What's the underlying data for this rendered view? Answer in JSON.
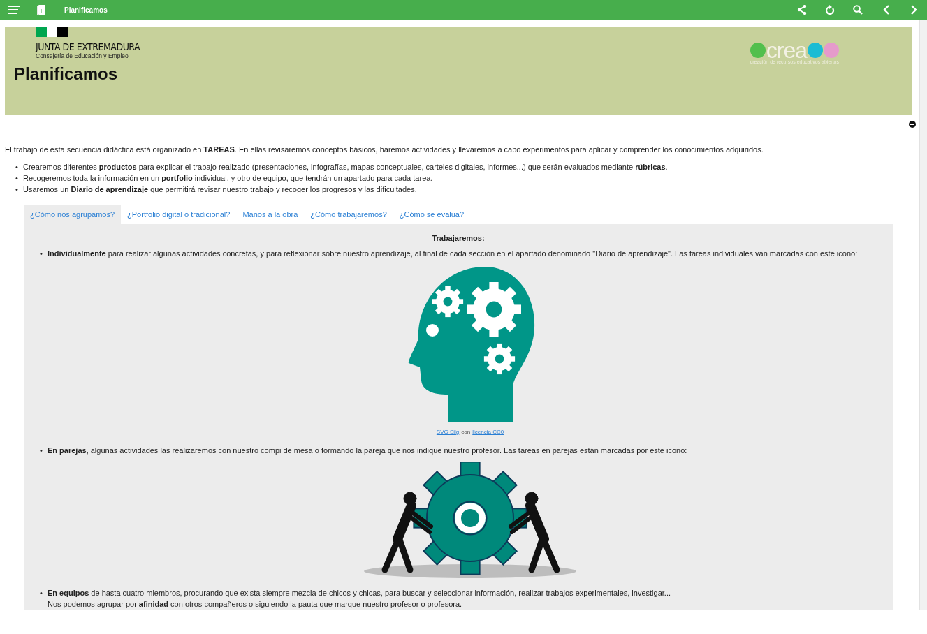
{
  "toolbar": {
    "title": "Planificamos"
  },
  "banner": {
    "org_name": "JUNTA DE EXTREMADURA",
    "org_subtitle": "Consejería de Educación y Empleo",
    "title": "Planificamos",
    "logo_text": "crea",
    "logo_tagline": "creación de recursos educativos abiertos"
  },
  "intro": "El trabajo de esta secuencia didáctica está organizado en **TAREAS**. En ellas revisaremos conceptos básicos, haremos actividades y llevaremos a cabo experimentos para aplicar y comprender los conocimientos adquiridos.",
  "bullets": [
    {
      "marker": "•",
      "text": "Crearemos diferentes **productos** para explicar el trabajo realizado (presentaciones, infografías, mapas conceptuales, carteles digitales, informes...) que serán evaluados mediante **rúbricas**."
    },
    {
      "marker": "•",
      "text": "Recogeremos toda la información en un **portfolio** individual, y otro de equipo, que tendrán un apartado para cada tarea."
    },
    {
      "marker": "•",
      "text": "Usaremos un **Diario de aprendizaje** que permitirá revisar nuestro trabajo y recoger los progresos y las dificultades."
    }
  ],
  "tabs": [
    {
      "label": "¿Cómo nos agrupamos?",
      "selected": true
    },
    {
      "label": "¿Portfolio digital o tradicional?",
      "selected": false
    },
    {
      "label": "Manos a la obra",
      "selected": false
    },
    {
      "label": "¿Cómo trabajaremos?",
      "selected": false
    },
    {
      "label": "¿Cómo se evalúa?",
      "selected": false
    }
  ],
  "panel": {
    "heading": "Trabajaremos:",
    "items": [
      {
        "marker": "•",
        "lines": [
          "**Individualmente** para realizar algunas actividades concretas, y para reflexionar sobre nuestro aprendizaje, al final de cada sección en el apartado denominado \"Diario de aprendizaje\". Las tareas individuales van marcadas con este icono:"
        ],
        "figure": {
          "kind": "head-gears",
          "caption": [
            {
              "kind": "link",
              "text": "SVG Silg"
            },
            {
              "kind": "text",
              "text": "con"
            },
            {
              "kind": "link",
              "text": "licencia CC0"
            }
          ]
        }
      },
      {
        "marker": "•",
        "lines": [
          "**En parejas**, algunas actividades las realizaremos con nuestro compi de mesa o formando la pareja que nos indique nuestro profesor. Las tareas en parejas están marcadas por este icono:"
        ],
        "figure": {
          "kind": "people-gear"
        }
      },
      {
        "marker": "•",
        "lines": [
          "**En equipos** de hasta cuatro miembros, procurando que exista siempre mezcla de chicos y chicas, para buscar y seleccionar información, realizar trabajos experimentales, investigar...",
          "Nos podemos agrupar por **afinidad** con otros compañeros o siguiendo la pauta que marque nuestro profesor o profesora."
        ]
      }
    ]
  }
}
